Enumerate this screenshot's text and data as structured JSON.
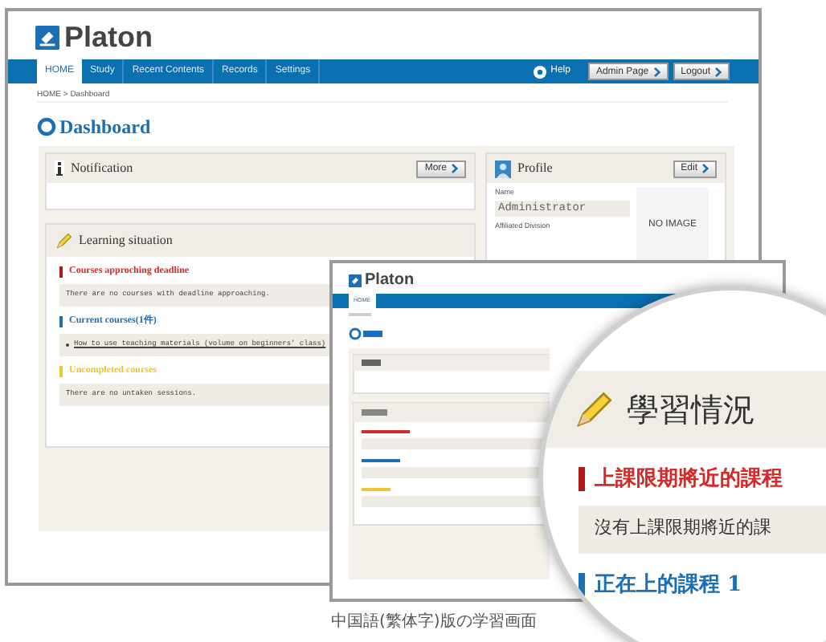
{
  "main": {
    "logo": "Platon",
    "nav": [
      {
        "label": "HOME",
        "selected": true
      },
      {
        "label": "Study",
        "selected": false
      },
      {
        "label": "Recent Contents",
        "selected": false
      },
      {
        "label": "Records",
        "selected": false
      },
      {
        "label": "Settings",
        "selected": false
      }
    ],
    "help": "Help",
    "buttons": [
      "Admin Page",
      "Logout"
    ],
    "breadcrumb": "HOME > Dashboard",
    "title": "Dashboard",
    "notification": {
      "title": "Notification",
      "button": "More"
    },
    "profile": {
      "title": "Profile",
      "button": "Edit",
      "name_label": "Name",
      "name_value": "Administrator",
      "division_label": "Affiliated Division",
      "no_image": "NO IMAGE"
    },
    "learning": {
      "title": "Learning situation",
      "sections": [
        {
          "kind": "deadline",
          "heading": "Courses approching deadline",
          "text": "There are no courses with deadline approaching."
        },
        {
          "kind": "current",
          "heading": "Current courses(1件)",
          "link": "How to use teaching materials (volume on beginners' class)"
        },
        {
          "kind": "uncompleted",
          "heading": "Uncompleted courses",
          "text": "There are no untaken sessions."
        }
      ]
    }
  },
  "zh": {
    "logo": "Platon",
    "nav_first": "HOME",
    "magnified": {
      "title": "學習情況",
      "sections": [
        {
          "kind": "deadline",
          "heading": "上課限期將近的課程",
          "text": "沒有上課限期將近的課"
        },
        {
          "kind": "current",
          "heading": "正在上的課程 1"
        }
      ]
    }
  },
  "caption": "中国語(繁体字)版の学習画面"
}
